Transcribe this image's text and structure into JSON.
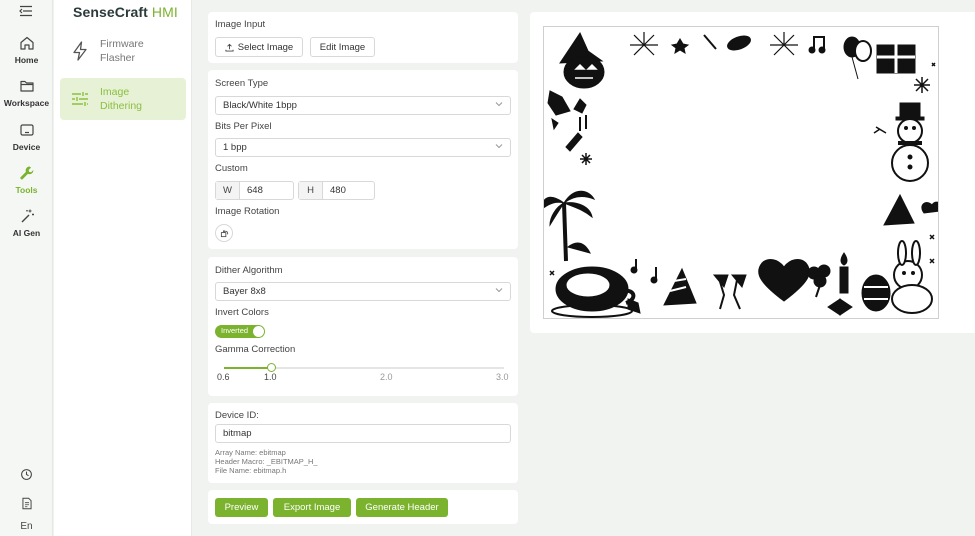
{
  "app": {
    "brand_name": "SenseCraft",
    "brand_accent": "HMI",
    "accent_color": "#7bb32e"
  },
  "rail": {
    "menu_icon": "collapse-menu-icon",
    "items": [
      {
        "label": "Home",
        "icon": "home-icon"
      },
      {
        "label": "Workspace",
        "icon": "folder-icon"
      },
      {
        "label": "Device",
        "icon": "device-icon"
      },
      {
        "label": "Tools",
        "icon": "wrench-icon",
        "active": true
      },
      {
        "label": "AI Gen",
        "icon": "magic-wand-icon"
      }
    ],
    "bottom": {
      "history_icon": "history-icon",
      "document_icon": "document-icon",
      "language": "En"
    }
  },
  "sidebar": {
    "items": [
      {
        "label": "Firmware Flasher",
        "icon": "lightning-icon"
      },
      {
        "label": "Image Dithering",
        "icon": "sliders-icon",
        "active": true
      }
    ]
  },
  "image_input": {
    "label": "Image Input",
    "select_button": "Select Image",
    "edit_button": "Edit Image"
  },
  "screen": {
    "screen_type_label": "Screen Type",
    "screen_type_value": "Black/White 1bpp",
    "bpp_label": "Bits Per Pixel",
    "bpp_value": "1 bpp",
    "custom_label": "Custom",
    "width_tag": "W",
    "width_value": "648",
    "height_tag": "H",
    "height_value": "480",
    "rotation_label": "Image Rotation"
  },
  "dither": {
    "algorithm_label": "Dither Algorithm",
    "algorithm_value": "Bayer 8x8",
    "invert_label": "Invert Colors",
    "invert_toggle_text": "Inverted",
    "invert_on": true,
    "gamma_label": "Gamma Correction",
    "gamma_min": "0.6",
    "gamma_value": "1.0",
    "gamma_tick_2": "2.0",
    "gamma_max": "3.0",
    "gamma_value_fraction": 0.167
  },
  "device": {
    "id_label": "Device ID:",
    "id_value": "bitmap",
    "array_name": "Array Name: ebitmap",
    "header_macro": "Header Macro: _EBITMAP_H_",
    "file_name": "File Name: ebitmap.h"
  },
  "actions": {
    "preview": "Preview",
    "export": "Export Image",
    "generate": "Generate Header"
  },
  "preview": {
    "description_icon": "holiday-doodle-border-image"
  }
}
